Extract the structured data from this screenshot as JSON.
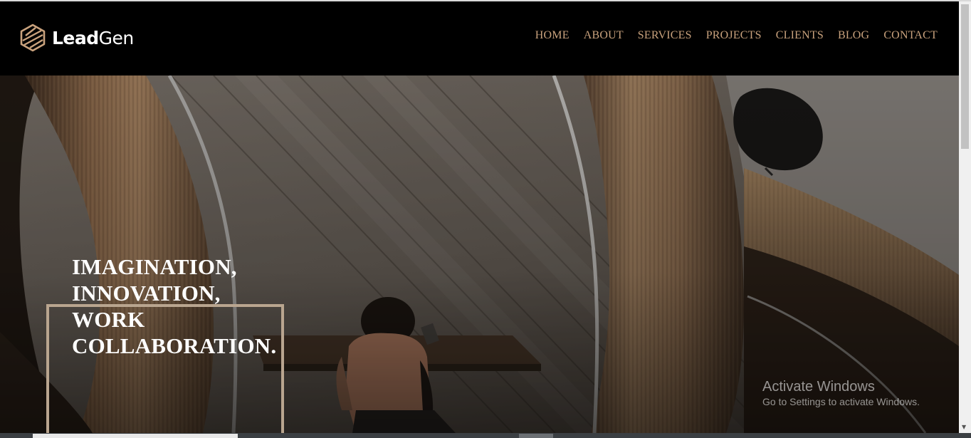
{
  "brand": {
    "name_bold": "Lead",
    "name_light": "Gen",
    "logo_icon": "hexagon-stripes-logo",
    "accent_color": "#c9a27d"
  },
  "nav": {
    "items": [
      {
        "label": "HOME"
      },
      {
        "label": "ABOUT"
      },
      {
        "label": "SERVICES"
      },
      {
        "label": "PROJECTS"
      },
      {
        "label": "CLIENTS"
      },
      {
        "label": "BLOG"
      },
      {
        "label": "CONTACT"
      }
    ]
  },
  "hero": {
    "title_lines": [
      "IMAGINATION,",
      "INNOVATION,",
      "WORK",
      "COLLABORATION."
    ],
    "background_description_icon": "hero-photo",
    "frame_color": "#b9a58f"
  },
  "watermark": {
    "title": "Activate Windows",
    "subtitle": "Go to Settings to activate Windows."
  }
}
